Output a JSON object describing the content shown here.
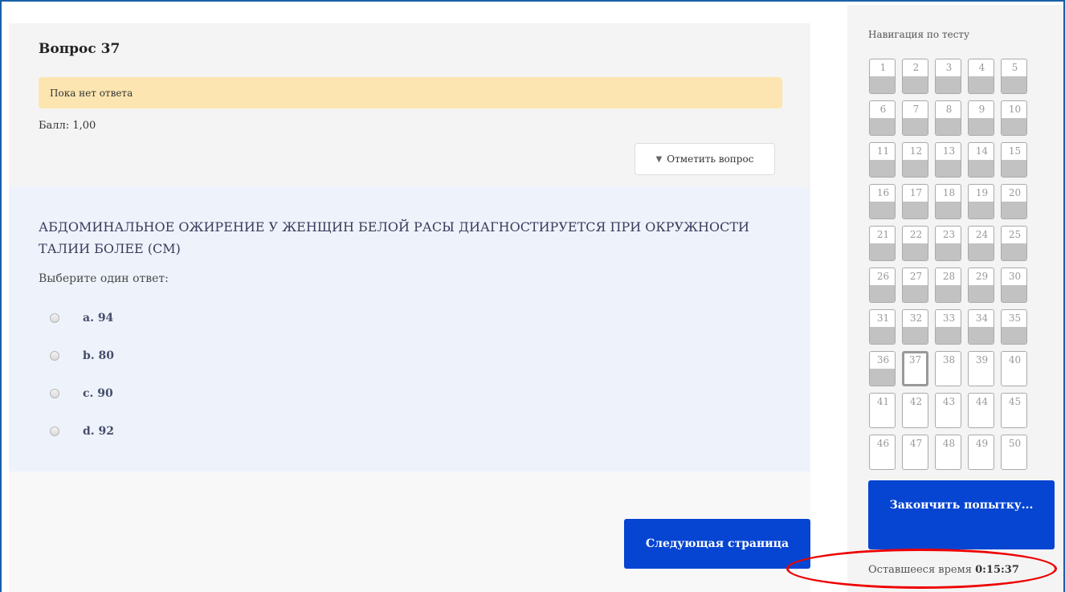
{
  "question": {
    "title": "Вопрос 37",
    "state": "Пока нет ответа",
    "grade": "Балл: 1,00",
    "flag_label": "Отметить вопрос",
    "flag_icon": "flag-icon",
    "text": "АБДОМИНАЛЬНОЕ ОЖИРЕНИЕ У ЖЕНЩИН БЕЛОЙ РАСЫ ДИАГНОСТИРУЕТСЯ ПРИ ОКРУЖНОСТИ ТАЛИИ БОЛЕЕ (СМ)",
    "prompt": "Выберите один ответ:",
    "answers": [
      {
        "label": "a. 94",
        "checked": false
      },
      {
        "label": "b. 80",
        "checked": false
      },
      {
        "label": "c. 90",
        "checked": false
      },
      {
        "label": "d. 92",
        "checked": false
      }
    ]
  },
  "next_button": "Следующая страница",
  "nav": {
    "title": "Навигация по тесту",
    "buttons": [
      {
        "num": "1",
        "answered": true
      },
      {
        "num": "2",
        "answered": true
      },
      {
        "num": "3",
        "answered": true
      },
      {
        "num": "4",
        "answered": true
      },
      {
        "num": "5",
        "answered": true
      },
      {
        "num": "6",
        "answered": true
      },
      {
        "num": "7",
        "answered": true
      },
      {
        "num": "8",
        "answered": true
      },
      {
        "num": "9",
        "answered": true
      },
      {
        "num": "10",
        "answered": true
      },
      {
        "num": "11",
        "answered": true
      },
      {
        "num": "12",
        "answered": true
      },
      {
        "num": "13",
        "answered": true
      },
      {
        "num": "14",
        "answered": true
      },
      {
        "num": "15",
        "answered": true
      },
      {
        "num": "16",
        "answered": true
      },
      {
        "num": "17",
        "answered": true
      },
      {
        "num": "18",
        "answered": true
      },
      {
        "num": "19",
        "answered": true
      },
      {
        "num": "20",
        "answered": true
      },
      {
        "num": "21",
        "answered": true
      },
      {
        "num": "22",
        "answered": true
      },
      {
        "num": "23",
        "answered": true
      },
      {
        "num": "24",
        "answered": true
      },
      {
        "num": "25",
        "answered": true
      },
      {
        "num": "26",
        "answered": true
      },
      {
        "num": "27",
        "answered": true
      },
      {
        "num": "28",
        "answered": true
      },
      {
        "num": "29",
        "answered": true
      },
      {
        "num": "30",
        "answered": true
      },
      {
        "num": "31",
        "answered": true
      },
      {
        "num": "32",
        "answered": true
      },
      {
        "num": "33",
        "answered": true
      },
      {
        "num": "34",
        "answered": true
      },
      {
        "num": "35",
        "answered": true
      },
      {
        "num": "36",
        "answered": true
      },
      {
        "num": "37",
        "answered": false,
        "current": true
      },
      {
        "num": "38",
        "answered": false
      },
      {
        "num": "39",
        "answered": false
      },
      {
        "num": "40",
        "answered": false
      },
      {
        "num": "41",
        "answered": false
      },
      {
        "num": "42",
        "answered": false
      },
      {
        "num": "43",
        "answered": false
      },
      {
        "num": "44",
        "answered": false
      },
      {
        "num": "45",
        "answered": false
      },
      {
        "num": "46",
        "answered": false
      },
      {
        "num": "47",
        "answered": false
      },
      {
        "num": "48",
        "answered": false
      },
      {
        "num": "49",
        "answered": false
      },
      {
        "num": "50",
        "answered": false
      }
    ],
    "finish_button": "Закончить попытку...",
    "timer_label": "Оставшееся время",
    "timer_value": "0:15:37"
  },
  "colors": {
    "accent": "#0645d1",
    "state_bar": "#fce5b0",
    "highlight_circle": "#e00000"
  }
}
